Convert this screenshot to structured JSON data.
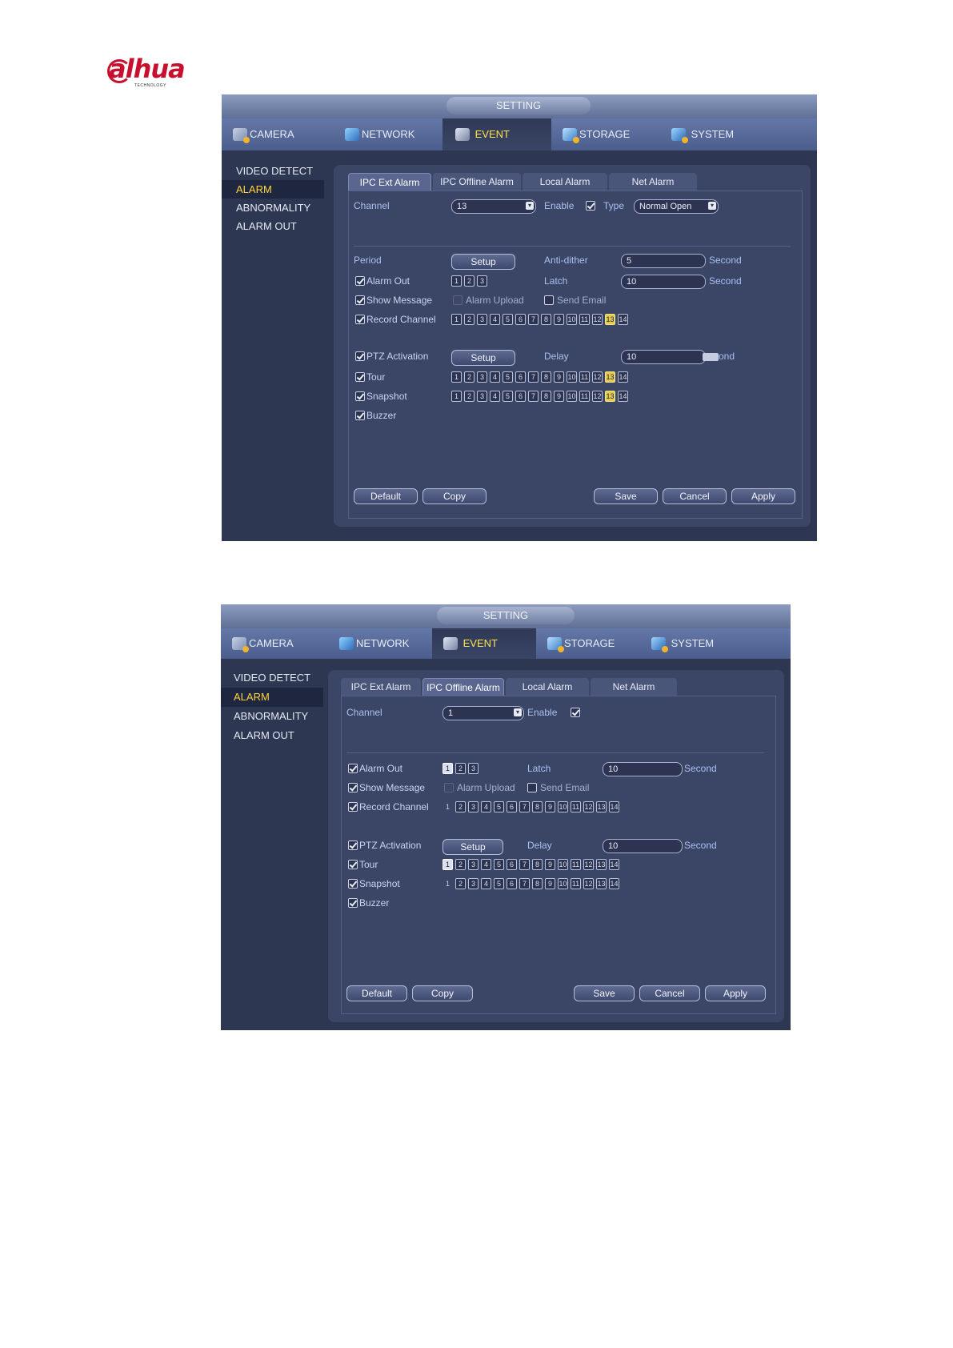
{
  "logo": {
    "brand": "alhua",
    "sub": "TECHNOLOGY"
  },
  "screen1": {
    "title": "SETTING",
    "menu": [
      {
        "label": "CAMERA",
        "icon": "camera-icon"
      },
      {
        "label": "NETWORK",
        "icon": "network-icon"
      },
      {
        "label": "EVENT",
        "icon": "event-icon"
      },
      {
        "label": "STORAGE",
        "icon": "storage-icon"
      },
      {
        "label": "SYSTEM",
        "icon": "system-icon"
      }
    ],
    "sidebar": [
      "VIDEO DETECT",
      "ALARM",
      "ABNORMALITY",
      "ALARM OUT"
    ],
    "tabs": [
      "IPC Ext Alarm",
      "IPC Offline Alarm",
      "Local Alarm",
      "Net Alarm"
    ],
    "active_tab": "IPC Ext Alarm",
    "channel_label": "Channel",
    "channel_value": "13",
    "enable_label": "Enable",
    "enable_checked": true,
    "type_label": "Type",
    "type_value": "Normal Open",
    "period_label": "Period",
    "setup_label": "Setup",
    "anti_dither_label": "Anti-dither",
    "anti_dither_value": "5",
    "second_label": "Second",
    "alarm_out_label": "Alarm Out",
    "alarm_out_nums": [
      "1",
      "2",
      "3"
    ],
    "latch_label": "Latch",
    "latch_value": "10",
    "show_message_label": "Show Message",
    "alarm_upload_label": "Alarm Upload",
    "send_email_label": "Send Email",
    "record_channel_label": "Record Channel",
    "ptz_label": "PTZ Activation",
    "delay_label": "Delay",
    "delay_value": "10",
    "delay_unit_partial": "ond",
    "tour_label": "Tour",
    "snapshot_label": "Snapshot",
    "buzzer_label": "Buzzer",
    "channels": [
      "1",
      "2",
      "3",
      "4",
      "5",
      "6",
      "7",
      "8",
      "9",
      "10",
      "11",
      "12",
      "13",
      "14"
    ],
    "selected_channel": "13",
    "buttons": {
      "default": "Default",
      "copy": "Copy",
      "save": "Save",
      "cancel": "Cancel",
      "apply": "Apply"
    }
  },
  "screen2": {
    "title": "SETTING",
    "menu": [
      {
        "label": "CAMERA",
        "icon": "camera-icon"
      },
      {
        "label": "NETWORK",
        "icon": "network-icon"
      },
      {
        "label": "EVENT",
        "icon": "event-icon"
      },
      {
        "label": "STORAGE",
        "icon": "storage-icon"
      },
      {
        "label": "SYSTEM",
        "icon": "system-icon"
      }
    ],
    "sidebar": [
      "VIDEO DETECT",
      "ALARM",
      "ABNORMALITY",
      "ALARM OUT"
    ],
    "tabs": [
      "IPC Ext Alarm",
      "IPC Offline Alarm",
      "Local Alarm",
      "Net Alarm"
    ],
    "active_tab": "IPC Offline Alarm",
    "channel_label": "Channel",
    "channel_value": "1",
    "enable_label": "Enable",
    "enable_checked": true,
    "alarm_out_label": "Alarm Out",
    "alarm_out_nums": [
      "1",
      "2",
      "3"
    ],
    "latch_label": "Latch",
    "latch_value": "10",
    "second_label": "Second",
    "show_message_label": "Show Message",
    "alarm_upload_label": "Alarm Upload",
    "send_email_label": "Send Email",
    "record_channel_label": "Record Channel",
    "ptz_label": "PTZ Activation",
    "setup_label": "Setup",
    "delay_label": "Delay",
    "delay_value": "10",
    "tour_label": "Tour",
    "snapshot_label": "Snapshot",
    "buzzer_label": "Buzzer",
    "channels": [
      "1",
      "2",
      "3",
      "4",
      "5",
      "6",
      "7",
      "8",
      "9",
      "10",
      "11",
      "12",
      "13",
      "14"
    ],
    "selected_channel": "1",
    "buttons": {
      "default": "Default",
      "copy": "Copy",
      "save": "Save",
      "cancel": "Cancel",
      "apply": "Apply"
    }
  }
}
